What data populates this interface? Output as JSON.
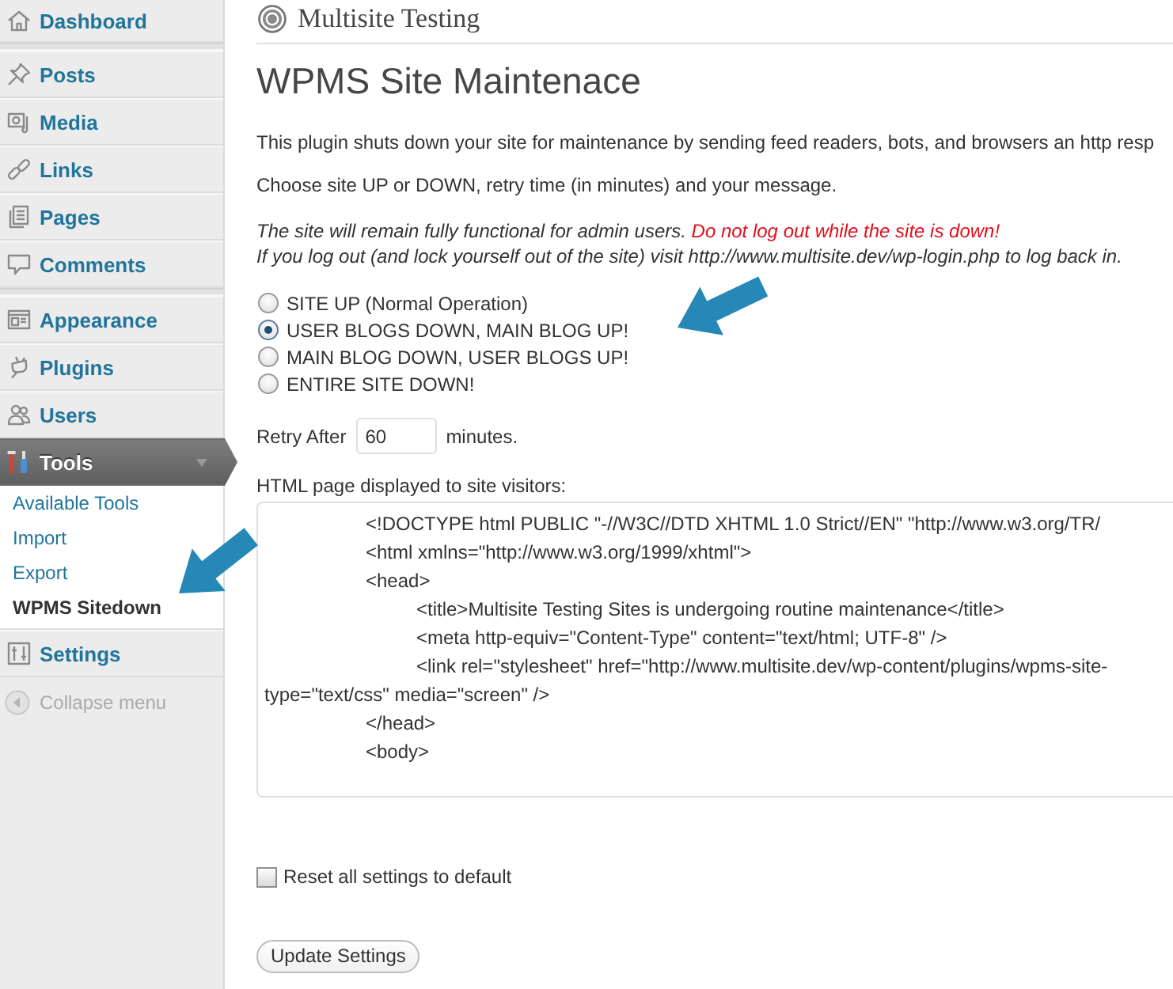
{
  "sidebar": {
    "groups": [
      {
        "items": [
          {
            "label": "Dashboard",
            "selected": false,
            "expanded": false
          }
        ]
      },
      {
        "items": [
          {
            "label": "Posts",
            "selected": false,
            "expanded": false
          },
          {
            "label": "Media",
            "selected": false,
            "expanded": false
          },
          {
            "label": "Links",
            "selected": false,
            "expanded": false
          },
          {
            "label": "Pages",
            "selected": false,
            "expanded": false
          },
          {
            "label": "Comments",
            "selected": false,
            "expanded": false
          }
        ]
      },
      {
        "items": [
          {
            "label": "Appearance",
            "selected": false,
            "expanded": false
          },
          {
            "label": "Plugins",
            "selected": false,
            "expanded": false
          },
          {
            "label": "Users",
            "selected": false,
            "expanded": false
          },
          {
            "label": "Tools",
            "selected": true,
            "expanded": true,
            "children": [
              {
                "label": "Available Tools",
                "selected": false
              },
              {
                "label": "Import",
                "selected": false
              },
              {
                "label": "Export",
                "selected": false
              },
              {
                "label": "WPMS Sitedown",
                "selected": true
              }
            ]
          },
          {
            "label": "Settings",
            "selected": false,
            "expanded": false
          }
        ]
      }
    ],
    "collapse_label": "Collapse menu"
  },
  "header": {
    "site_title": "Multisite Testing"
  },
  "page": {
    "title": "WPMS Site Maintenace",
    "paragraphs": [
      "This plugin shuts down your site for maintenance by sending feed readers, bots, and browsers an http resp",
      "Choose site UP or DOWN, retry time (in minutes) and your message."
    ],
    "notice": {
      "text": "The site will remain fully functional for admin users.",
      "warning": "Do not log out while the site is down!"
    },
    "login_hint": "If you log out (and lock yourself out of the site) visit http://www.multisite.dev/wp-login.php to log back in.",
    "modes": [
      {
        "label": "SITE UP (Normal Operation)",
        "selected": false
      },
      {
        "label": "USER BLOGS DOWN, MAIN BLOG UP!",
        "selected": true
      },
      {
        "label": "MAIN BLOG DOWN, USER BLOGS UP!",
        "selected": false
      },
      {
        "label": "ENTIRE SITE DOWN!",
        "selected": false
      }
    ],
    "retry": {
      "label": "Retry After",
      "value": "60",
      "unit": "minutes."
    },
    "message": {
      "label": "HTML page displayed to site visitors:",
      "value": "\t\t<!DOCTYPE html PUBLIC \"-//W3C//DTD XHTML 1.0 Strict//EN\" \"http://www.w3.org/TR/\n\t\t<html xmlns=\"http://www.w3.org/1999/xhtml\">\n\t\t<head>\n\t\t\t<title>Multisite Testing Sites is undergoing routine maintenance</title>\n\t\t\t<meta http-equiv=\"Content-Type\" content=\"text/html; UTF-8\" />\n\t\t\t<link rel=\"stylesheet\" href=\"http://www.multisite.dev/wp-content/plugins/wpms-site-\ntype=\"text/css\" media=\"screen\" />\n\t\t</head>\n\t\t<body>"
    },
    "reset": {
      "label": "Reset all settings to default",
      "checked": false
    },
    "submit": "Update Settings"
  }
}
